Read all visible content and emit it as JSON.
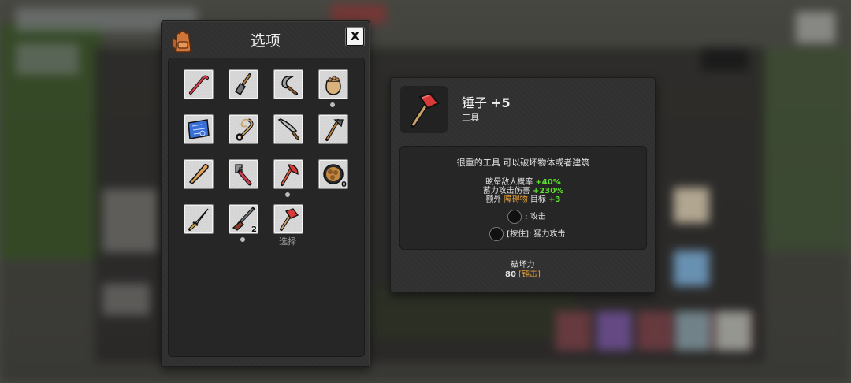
{
  "inventory": {
    "title": "选项",
    "close_label": "X",
    "slots": [
      {
        "name": "crowbar",
        "dot": false
      },
      {
        "name": "shovel",
        "dot": false
      },
      {
        "name": "sickle",
        "dot": false
      },
      {
        "name": "sack",
        "dot": true
      },
      {
        "name": "blueprint",
        "dot": false
      },
      {
        "name": "rope",
        "dot": false
      },
      {
        "name": "machete",
        "dot": false
      },
      {
        "name": "hoe",
        "dot": false
      },
      {
        "name": "baseball-bat",
        "dot": false
      },
      {
        "name": "wrench",
        "dot": false
      },
      {
        "name": "fire-axe",
        "dot": true
      },
      {
        "name": "nut-bowl",
        "count": "0",
        "dot": false
      },
      {
        "name": "katana",
        "dot": false
      },
      {
        "name": "shotgun",
        "count": "2",
        "dot": true
      },
      {
        "name": "sledgehammer",
        "dot": false,
        "label": "选择"
      }
    ],
    "selected_label": "选择",
    "shotgun_count": "2",
    "bowl_count": "0"
  },
  "detail": {
    "name": "锤子",
    "level": "+5",
    "type": "工具",
    "description": "很重的工具 可以破坏物体或者建筑",
    "stats": {
      "stagger_label": "眩晕敌人概率",
      "stagger_value": "+40%",
      "charge_label": "蓄力攻击伤害",
      "charge_value": "+230%",
      "extra_prefix": "额外",
      "extra_obstacle": "障碍物",
      "extra_target": "目标",
      "extra_value": "+3"
    },
    "controls": {
      "attack_label": ": 攻击",
      "hold_label": "[按住]: 猛力攻击"
    },
    "damage": {
      "label": "破坏力",
      "value": "80",
      "type_open": "[",
      "type": "钝击",
      "type_close": "]"
    }
  },
  "colors": {
    "panel": "#303030",
    "inner": "#262626",
    "stat_green": "#5de32e",
    "accent_orange": "#e8a23a"
  }
}
